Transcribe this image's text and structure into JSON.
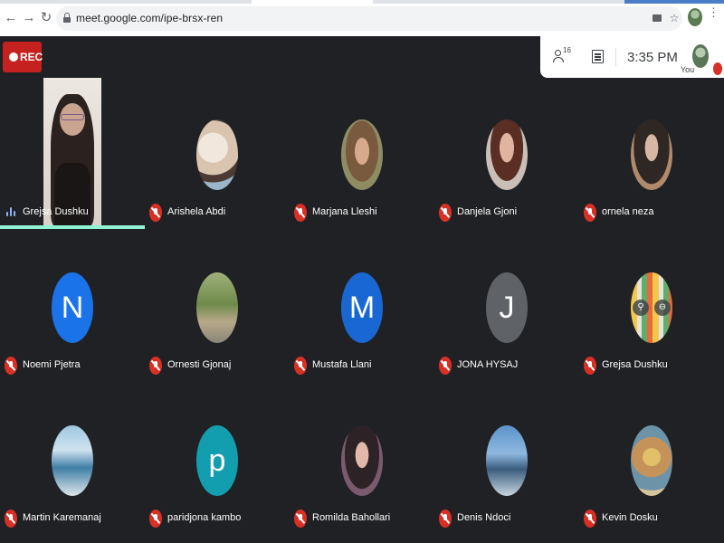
{
  "browser": {
    "url": "meet.google.com/ipe-brsx-ren",
    "icons": {
      "back": "back-arrow-icon",
      "forward": "forward-arrow-icon",
      "reload": "reload-icon",
      "lock": "lock-icon",
      "camera": "camera-blocked-icon",
      "star": "star-icon",
      "menu": "more-vert-icon"
    }
  },
  "meeting": {
    "rec_label": "REC",
    "people_count": "16",
    "time": "3:35 PM",
    "you_label": "You"
  },
  "colors": {
    "background": "#202124",
    "mic_off": "#d93025",
    "speaking_bar": "#8ff3d3",
    "rec": "#c5221f"
  },
  "participants": [
    {
      "name": "Grejsa Dushku",
      "state": "speaking",
      "view": "camera"
    },
    {
      "name": "Arishela Abdi",
      "state": "muted",
      "view": "photo"
    },
    {
      "name": "Marjana Lleshi",
      "state": "muted",
      "view": "photo"
    },
    {
      "name": "Danjela Gjoni",
      "state": "muted",
      "view": "photo"
    },
    {
      "name": "ornela neza",
      "state": "muted",
      "view": "photo"
    },
    {
      "name": "Noemi Pjetra",
      "state": "muted",
      "view": "letter",
      "initial": "N",
      "avatar_color": "#1a73e8"
    },
    {
      "name": "Ornesti Gjonaj",
      "state": "muted",
      "view": "photo"
    },
    {
      "name": "Mustafa Llani",
      "state": "muted",
      "view": "letter",
      "initial": "M",
      "avatar_color": "#1967d2"
    },
    {
      "name": "JONA HYSAJ",
      "state": "muted",
      "view": "letter",
      "initial": "J",
      "avatar_color": "#5f6368"
    },
    {
      "name": "Grejsa Dushku",
      "state": "muted",
      "view": "photo"
    },
    {
      "name": "Martin Karemanaj",
      "state": "muted",
      "view": "photo"
    },
    {
      "name": "paridjona kambo",
      "state": "muted",
      "view": "letter",
      "initial": "p",
      "avatar_color": "#129eaf"
    },
    {
      "name": "Romilda Bahollari",
      "state": "muted",
      "view": "photo"
    },
    {
      "name": "Denis Ndoci",
      "state": "muted",
      "view": "photo"
    },
    {
      "name": "Kevin Dosku",
      "state": "muted",
      "view": "photo"
    }
  ]
}
